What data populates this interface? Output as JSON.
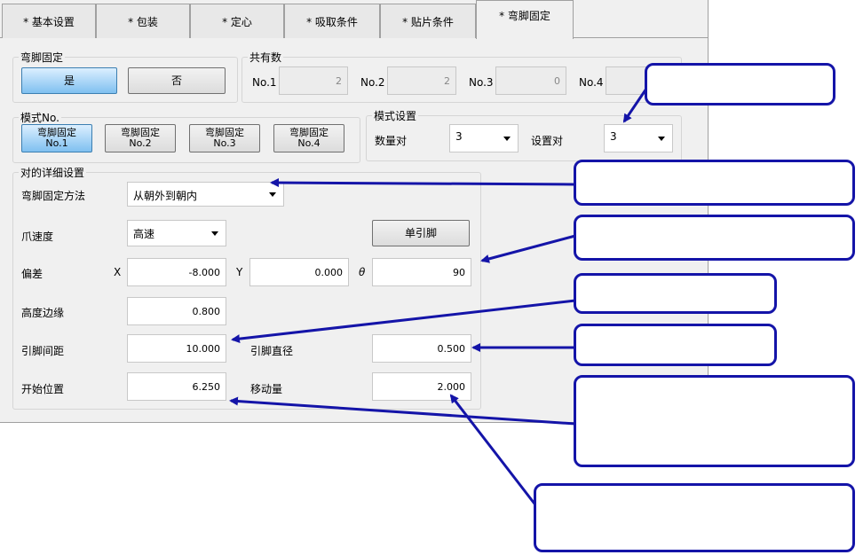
{
  "tabs": [
    {
      "label": "* 基本设置"
    },
    {
      "label": "* 包装"
    },
    {
      "label": "* 定心"
    },
    {
      "label": "* 吸取条件"
    },
    {
      "label": "* 贴片条件"
    },
    {
      "label": "* 弯脚固定"
    }
  ],
  "active_tab": 5,
  "lead_fix": {
    "legend": "弯脚固定",
    "yes_label": "是",
    "no_label": "否"
  },
  "shared": {
    "legend": "共有数",
    "items": [
      {
        "label": "No.1",
        "value": "2"
      },
      {
        "label": "No.2",
        "value": "2"
      },
      {
        "label": "No.3",
        "value": "0"
      },
      {
        "label": "No.4",
        "value": ""
      }
    ]
  },
  "mode_no": {
    "legend": "模式No.",
    "buttons": [
      {
        "line1": "弯脚固定",
        "line2": "No.1"
      },
      {
        "line1": "弯脚固定",
        "line2": "No.2"
      },
      {
        "line1": "弯脚固定",
        "line2": "No.3"
      },
      {
        "line1": "弯脚固定",
        "line2": "No.4"
      }
    ]
  },
  "mode_set": {
    "legend": "模式设置",
    "count_label": "数量对",
    "count_value": "3",
    "set_label": "设置对",
    "set_value": "3"
  },
  "detail": {
    "legend": "对的详细设置",
    "method_label": "弯脚固定方法",
    "method_value": "从朝外到朝内",
    "speed_label": "爪速度",
    "speed_value": "高速",
    "single_lead_button": "单引脚",
    "offset_label": "偏差",
    "x_label": "X",
    "x_value": "-8.000",
    "y_label": "Y",
    "y_value": "0.000",
    "theta_label": "θ",
    "theta_value": "90",
    "height_label": "高度边缘",
    "height_value": "0.800",
    "pitch_label": "引脚间距",
    "pitch_value": "10.000",
    "diameter_label": "引脚直径",
    "diameter_value": "0.500",
    "start_label": "开始位置",
    "start_value": "6.250",
    "move_label": "移动量",
    "move_value": "2.000"
  },
  "colors": {
    "callout_border": "#1414a8",
    "arrow": "#1414a8",
    "selected_button": "#7fc0f0",
    "panel_bg": "#f0f0f0"
  }
}
